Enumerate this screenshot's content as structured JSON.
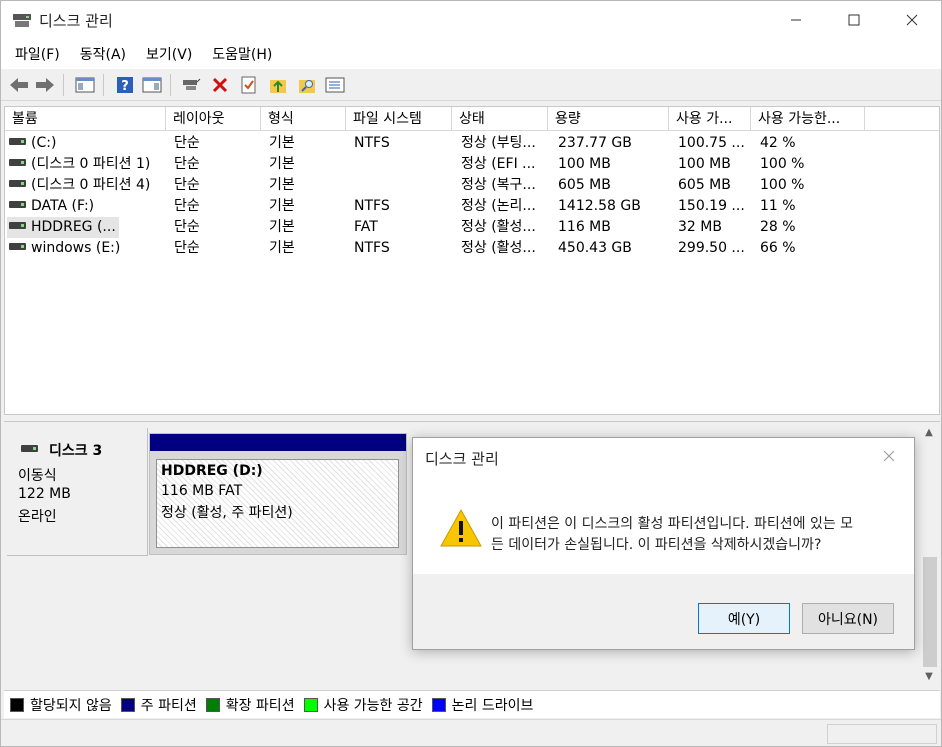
{
  "window": {
    "title": "디스크 관리"
  },
  "menu": [
    "파일(F)",
    "동작(A)",
    "보기(V)",
    "도움말(H)"
  ],
  "toolbar_icons": [
    "back-icon",
    "forward-icon",
    "console-tree-icon",
    "help-icon",
    "action-pane-icon",
    "connect-disk-icon",
    "delete-icon",
    "check-icon",
    "up-arrow-folder-icon",
    "search-folder-icon",
    "list-view-icon"
  ],
  "columns": [
    "볼륨",
    "레이아웃",
    "형식",
    "파일 시스템",
    "상태",
    "용량",
    "사용 가...",
    "사용 가능한..."
  ],
  "volumes": [
    {
      "name": "(C:)",
      "layout": "단순",
      "type": "기본",
      "fs": "NTFS",
      "status": "정상 (부팅...",
      "capacity": "237.77 GB",
      "free": "100.75 ...",
      "pct": "42 %"
    },
    {
      "name": "(디스크 0 파티션 1)",
      "layout": "단순",
      "type": "기본",
      "fs": "",
      "status": "정상 (EFI ...",
      "capacity": "100 MB",
      "free": "100 MB",
      "pct": "100 %"
    },
    {
      "name": "(디스크 0 파티션 4)",
      "layout": "단순",
      "type": "기본",
      "fs": "",
      "status": "정상 (복구...",
      "capacity": "605 MB",
      "free": "605 MB",
      "pct": "100 %"
    },
    {
      "name": "DATA (F:)",
      "layout": "단순",
      "type": "기본",
      "fs": "NTFS",
      "status": "정상 (논리...",
      "capacity": "1412.58 GB",
      "free": "150.19 ...",
      "pct": "11 %"
    },
    {
      "name": "HDDREG (...",
      "layout": "단순",
      "type": "기본",
      "fs": "FAT",
      "status": "정상 (활성...",
      "capacity": "116 MB",
      "free": "32 MB",
      "pct": "28 %"
    },
    {
      "name": "windows (E:)",
      "layout": "단순",
      "type": "기본",
      "fs": "NTFS",
      "status": "정상 (활성...",
      "capacity": "450.43 GB",
      "free": "299.50 ...",
      "pct": "66 %"
    }
  ],
  "disk": {
    "name": "디스크 3",
    "kind": "이동식",
    "size": "122 MB",
    "state": "온라인"
  },
  "partition": {
    "title": "HDDREG  (D:)",
    "size_fs": "116 MB FAT",
    "status": "정상 (활성, 주 파티션)"
  },
  "legend": [
    {
      "label": "할당되지 않음",
      "color": "#000000"
    },
    {
      "label": "주 파티션",
      "color": "#000080"
    },
    {
      "label": "확장 파티션",
      "color": "#008000"
    },
    {
      "label": "사용 가능한 공간",
      "color": "#00ff00"
    },
    {
      "label": "논리 드라이브",
      "color": "#0000ff"
    }
  ],
  "dialog": {
    "title": "디스크 관리",
    "message_line1": "이 파티션은 이 디스크의 활성 파티션입니다. 파티션에 있는 모",
    "message_line2": "든 데이터가 손실됩니다. 이 파티션을 삭제하시겠습니까?",
    "yes": "예(Y)",
    "no": "아니요(N)"
  }
}
